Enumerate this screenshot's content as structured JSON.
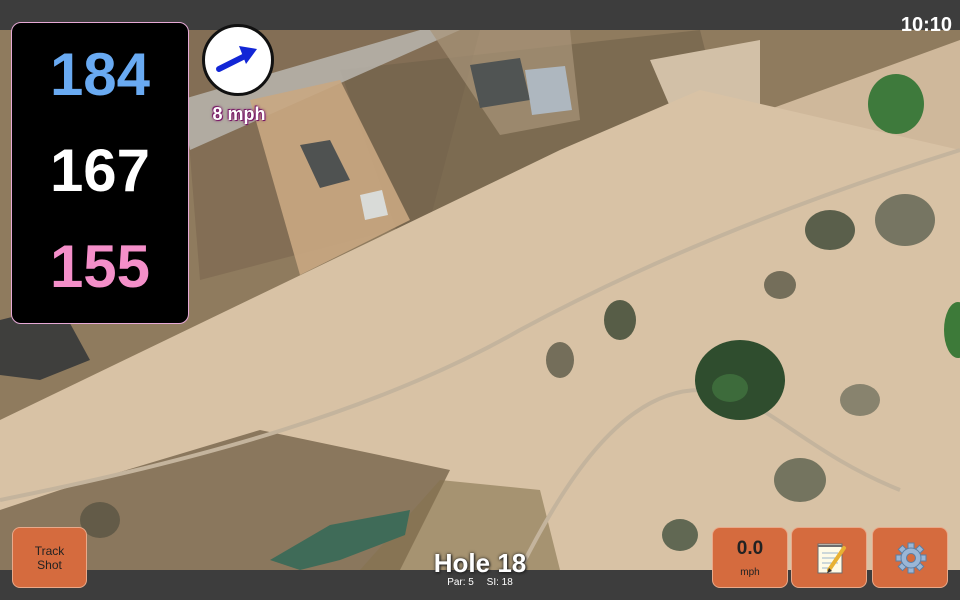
{
  "status": {
    "time": "10:10"
  },
  "distances": {
    "back": "184",
    "middle": "167",
    "front": "155"
  },
  "wind": {
    "speed_label": "8 mph",
    "direction": "east-northeast",
    "arrow_icon": "wind-arrow-icon"
  },
  "buttons": {
    "track_shot": {
      "line1": "Track",
      "line2": "Shot"
    },
    "speed": {
      "value": "0.0",
      "unit": "mph"
    },
    "notes_icon": "notepad-icon",
    "settings_icon": "gear-icon"
  },
  "hole": {
    "title": "Hole 18",
    "par": "Par: 5",
    "si": "SI: 18"
  },
  "colors": {
    "back": "#69aaf2",
    "middle": "#ffffff",
    "front": "#f48fc9",
    "button": "#d56b3e",
    "wind_arrow": "#1226d6"
  }
}
